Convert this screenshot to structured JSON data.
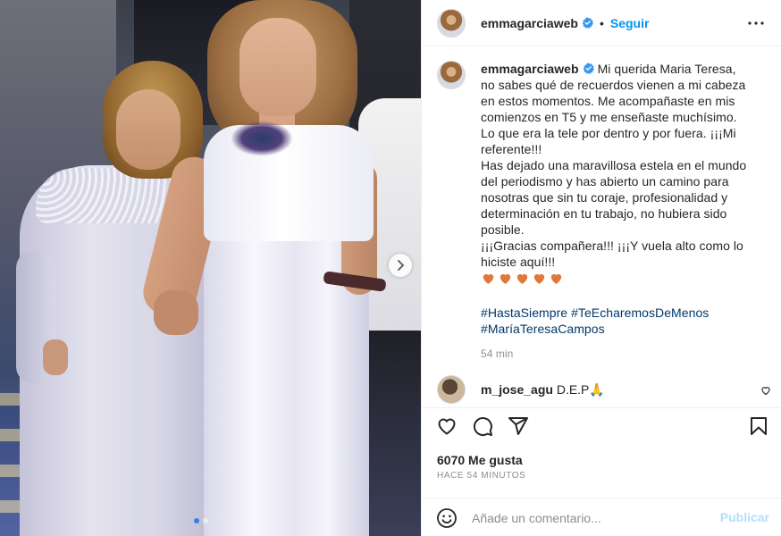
{
  "post": {
    "username": "emmagarciaweb",
    "separator": "•",
    "follow_label": "Seguir",
    "more_icon": "more-horizontal-icon"
  },
  "caption": {
    "username": "emmagarciaweb",
    "lines": [
      "Mi querida Maria Teresa,",
      "no sabes qué de recuerdos vienen a mi cabeza",
      "en estos momentos. Me acompañaste en mis",
      "comienzos en T5 y me enseñaste muchísimo.",
      "Lo que era la tele por dentro y por fuera. ¡¡¡Mi",
      "referente!!!",
      "Has dejado una maravillosa estela en el mundo",
      "del periodismo y has abierto un camino para",
      "nosotras que sin tu coraje, profesionalidad y",
      "determinación en tu trabajo, no hubiera sido",
      "posible.",
      "¡¡¡Gracias compañera!!! ¡¡¡Y vuela alto como lo",
      "hiciste aquí!!!"
    ],
    "hearts": "🧡🧡🧡🧡🧡",
    "hashtags": [
      "#HastaSiempre #TeEcharemosDeMenos",
      "#MaríaTeresaCampos"
    ],
    "time": "54 min"
  },
  "comment": {
    "username": "m_jose_agu",
    "text": "D.E.P🙏"
  },
  "stats": {
    "likes": "6070 Me gusta",
    "time": "HACE 54 MINUTOS"
  },
  "add_comment": {
    "placeholder": "Añade un comentario...",
    "publish_label": "Publicar"
  },
  "colors": {
    "link": "#0095f6",
    "hashtag": "#00376b",
    "muted": "#8e8e8e",
    "heart": "#e0783a"
  },
  "carousel": {
    "current": 1,
    "total": 2
  }
}
